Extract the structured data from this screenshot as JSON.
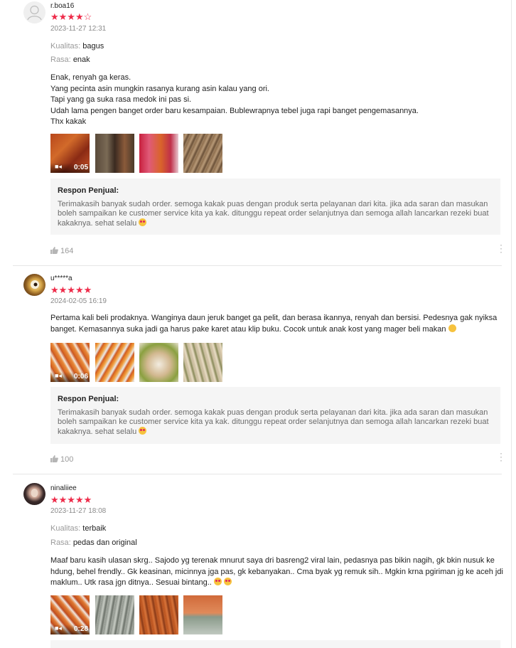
{
  "reviews": [
    {
      "username": "r.boa16",
      "stars": "★★★★",
      "stars_empty": "☆",
      "rating": 4,
      "date": "2023-11-27 12:31",
      "kualitas_label": "Kualitas:",
      "kualitas_value": "bagus",
      "rasa_label": "Rasa:",
      "rasa_value": "enak",
      "lines": [
        "Enak, renyah ga keras.",
        "Yang pecinta asin mungkin rasanya kurang asin kalau yang ori.",
        "Tapi yang ga suka rasa medok ini pas si.",
        "Udah lama pengen banget order baru kesampaian. Bublewrapnya tebel juga rapi banget pengemasannya.",
        "Thx kakak"
      ],
      "video_duration": "0:05",
      "reply_title": "Respon Penjual:",
      "reply_text": "Terimakasih banyak sudah order. semoga kakak puas dengan produk serta pelayanan dari kita. jika ada saran dan masukan boleh sampaikan ke customer service kita ya kak. ditunggu repeat order selanjutnya dan semoga allah lancarkan rezeki buat kakaknya. sehat selalu",
      "likes": "164"
    },
    {
      "username": "u*****a",
      "stars": "★★★★★",
      "rating": 5,
      "date": "2024-02-05 16:19",
      "text": "Pertama kali beli prodaknya. Wanginya daun jeruk banget ga pelit, dan berasa ikannya, renyah dan bersisi. Pedesnya gak nyiksa banget. Kemasannya suka jadi ga harus pake karet atau klip buku. Cocok untuk anak kost yang mager beli makan",
      "video_duration": "0:06",
      "reply_title": "Respon Penjual:",
      "reply_text": "Terimakasih banyak sudah order. semoga kakak puas dengan produk serta pelayanan dari kita. jika ada saran dan masukan boleh sampaikan ke customer service kita ya kak. ditunggu repeat order selanjutnya dan semoga allah lancarkan rezeki buat kakaknya. sehat selalu",
      "likes": "100"
    },
    {
      "username": "ninaliiee",
      "stars": "★★★★★",
      "rating": 5,
      "date": "2023-11-27 18:08",
      "kualitas_label": "Kualitas:",
      "kualitas_value": "terbaik",
      "rasa_label": "Rasa:",
      "rasa_value": "pedas dan original",
      "text": "Maaf baru kasih ulasan skrg.. Sajodo yg terenak mnurut saya dri basreng2 viral lain, pedasnya pas bikin nagih, gk bkin nusuk ke hdung, behel frendly.. Gk keasinan, micinnya jga pas, gk kebanyakan.. Cma byak yg remuk sih.. Mgkin krna pgiriman jg ke aceh jdi maklum.. Utk rasa jgn ditnya.. Sesuai bintang..",
      "video_duration": "0:28"
    }
  ],
  "colors": {
    "star": "#ee2c4a",
    "muted": "#8a8a8a",
    "reply_bg": "#f5f5f5"
  },
  "icons": {
    "like": "thumb-up-icon",
    "more": "more-vertical-icon",
    "video": "video-camera-icon"
  }
}
